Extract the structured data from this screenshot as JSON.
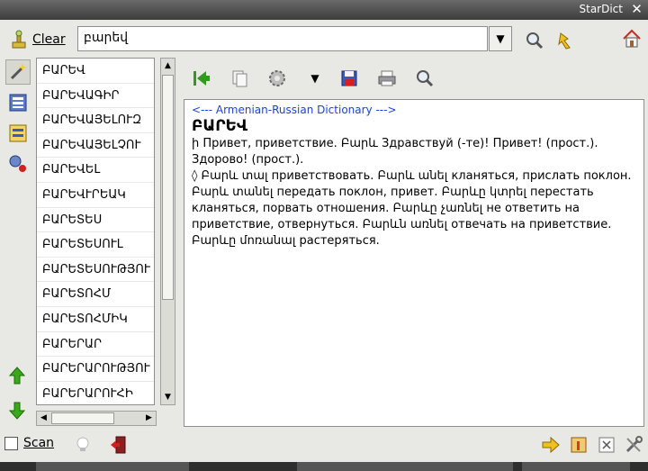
{
  "window": {
    "title": "StarDict",
    "close_glyph": "✕"
  },
  "toolbar": {
    "clear_label": "Clear",
    "search_value": "բարեվ",
    "dropdown_glyph": "▼"
  },
  "wordlist": {
    "items": [
      "ԲԱՐԵՎ",
      "ԲԱՐԵՎԱԳԻՐ",
      "ԲԱՐԵՎԱՅԵԼՈՒԶ",
      "ԲԱՐԵՎԱՅԵԼՉՈՒ",
      "ԲԱՐԵՎԵԼ",
      "ԲԱՐԵՎՒՐԵԱԿ",
      "ԲԱՐԵՏԵՍ",
      "ԲԱՐԵՏԵՍՈՒԼ",
      "ԲԱՐԵՏԵՍՈՒԹՅՈՒ",
      "ԲԱՐԵՏՈՀՄ",
      "ԲԱՐԵՏՈՀՄԻԿ",
      "ԲԱՐԵՐԱՐ",
      "ԲԱՐԵՐԱՐՈՒԹՅՈՒ",
      "ԲԱՐԵՐԱՐՈՒՀԻ"
    ]
  },
  "article": {
    "dict_name": "<--- Armenian-Russian Dictionary --->",
    "headword": "ԲԱՐԵՎ",
    "definition": "ի Привет, приветствие. Բարև Здравствуй (-те)! Привет! (прост.). Здорово! (прост.).\n◊ Բարև տալ приветствовать. Բարև անել кланяться, прислать поклон. Բարև տանել передать поклон, привет. Բարևը կտրել перестать кланяться, порвать отношения. Բարևը չառնել не ответить на приветствие, отвернуться. Բարևն առնել отвечать на приветствие. Բարևը մոռանալ растеряться."
  },
  "status": {
    "scan_label": "Scan"
  },
  "colors": {
    "accent_blue": "#1f3fd6",
    "green_arrow": "#2f9a1c"
  },
  "icons": [
    "broom-icon",
    "search-icon",
    "fulltext-search-icon",
    "home-icon",
    "wand-icon",
    "dict-list-icon",
    "dict-tree-icon",
    "network-icon",
    "go-first-icon",
    "copy-icon",
    "gear-icon",
    "save-icon",
    "print-icon",
    "find-icon",
    "arrow-up-icon",
    "arrow-down-icon",
    "bulb-icon",
    "exit-icon",
    "forward-icon",
    "dict-manage-icon",
    "info-icon",
    "preferences-icon"
  ]
}
